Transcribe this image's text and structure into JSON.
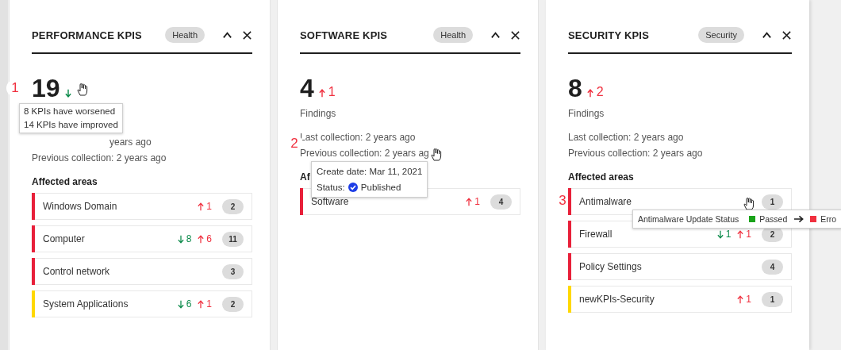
{
  "panels": [
    {
      "title": "PERFORMANCE KPIS",
      "tag": "Health",
      "value": "19",
      "trend": {
        "kind": "down",
        "hovered": true
      },
      "last_collection": "years ago",
      "previous_collection": "Previous collection: 2 years ago",
      "areas_heading": "Affected areas",
      "marker": "1",
      "tooltip": {
        "kind": "trend",
        "lines": [
          "8 KPIs have worsened",
          "14 KPIs have improved"
        ]
      },
      "areas": [
        {
          "name": "Windows Domain",
          "color": "#e8203a",
          "worsened": "1",
          "count": "2"
        },
        {
          "name": "Computer",
          "color": "#e8203a",
          "improved": "8",
          "worsened": "6",
          "count": "11"
        },
        {
          "name": "Control network",
          "color": "#e8203a",
          "count": "3"
        },
        {
          "name": "System Applications",
          "color": "#ffd800",
          "improved": "6",
          "worsened": "1",
          "count": "2"
        }
      ]
    },
    {
      "title": "SOFTWARE KPIS",
      "tag": "Health",
      "value": "4",
      "trend": {
        "kind": "up",
        "value": "1"
      },
      "findings_label": "Findings",
      "last_collection": "Last collection: 2 years ago",
      "previous_collection": "Previous collection: 2 years ag",
      "previous_hovered": true,
      "areas_heading": "Af",
      "marker": "2",
      "tooltip": {
        "kind": "collection",
        "create_date": "Create date: Mar 11, 2021",
        "status_label": "Status:",
        "status": "Published"
      },
      "areas": [
        {
          "name": "Software",
          "color": "#e8203a",
          "worsened": "1",
          "count": "4"
        }
      ]
    },
    {
      "title": "SECURITY KPIS",
      "tag": "Security",
      "value": "8",
      "trend": {
        "kind": "up",
        "value": "2"
      },
      "findings_label": "Findings",
      "last_collection": "Last collection: 2 years ago",
      "previous_collection": "Previous collection: 2 years ago",
      "areas_heading": "Affected areas",
      "marker": "3",
      "tooltip": {
        "kind": "status",
        "title": "Antimalware Update Status",
        "statuses": [
          {
            "label": "Passed",
            "color": "#1aa31a"
          },
          {
            "label": "Erro",
            "color": "#f0303f"
          }
        ]
      },
      "areas": [
        {
          "name": "Antimalware",
          "color": "#e8203a",
          "count": "1",
          "hovered": true
        },
        {
          "name": "Firewall",
          "color": "#e8203a",
          "improved": "1",
          "worsened": "1",
          "count": "2"
        },
        {
          "name": "Policy Settings",
          "color": "#e8203a",
          "count": "4"
        },
        {
          "name": "newKPIs-Security",
          "color": "#ffd800",
          "worsened": "1",
          "count": "1"
        }
      ]
    }
  ]
}
